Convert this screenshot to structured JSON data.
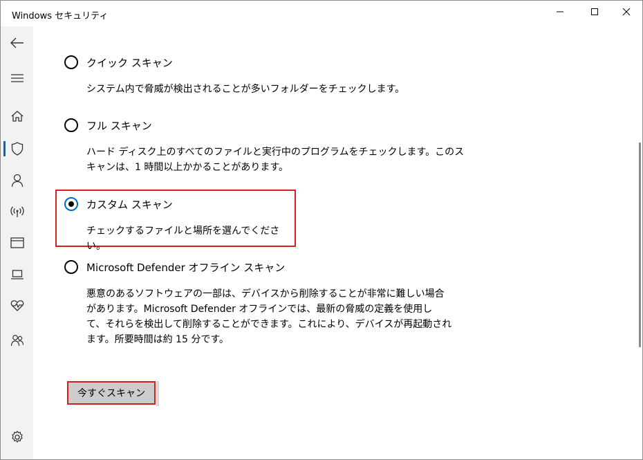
{
  "window": {
    "title": "Windows セキュリティ",
    "controls": [
      "minimize-icon",
      "maximize-icon",
      "close-icon"
    ]
  },
  "sidebar": {
    "items": [
      {
        "icon": "back-arrow-icon"
      },
      {
        "icon": "hamburger-menu-icon"
      },
      {
        "icon": "home-icon"
      },
      {
        "icon": "shield-icon",
        "active": true
      },
      {
        "icon": "person-icon"
      },
      {
        "icon": "network-icon"
      },
      {
        "icon": "app-browser-icon"
      },
      {
        "icon": "laptop-icon"
      },
      {
        "icon": "heart-pulse-icon"
      },
      {
        "icon": "family-icon"
      },
      {
        "icon": "gear-icon"
      }
    ],
    "accent": "#0067c0"
  },
  "scan_options": [
    {
      "label": "クイック スキャン",
      "description": "システム内で脅威が検出されることが多いフォルダーをチェックします。",
      "selected": false
    },
    {
      "label": "フル スキャン",
      "description_lines": [
        "ハード ディスク上のすべてのファイルと実行中のプログラムをチェックします。このス",
        "キャンは、1 時間以上かかることがあります。"
      ],
      "selected": false
    },
    {
      "label": "カスタム スキャン",
      "description": "チェックするファイルと場所を選んでください。",
      "selected": true
    },
    {
      "label": "Microsoft Defender オフライン スキャン",
      "description_lines": [
        "悪意のあるソフトウェアの一部は、デバイスから削除することが非常に難しい場合",
        "があります。Microsoft Defender オフラインでは、最新の脅威の定義を使用し",
        "て、それらを検出して削除することができます。これにより、デバイスが再起動され",
        "ます。所要時間は約 15 分です。"
      ],
      "selected": false
    }
  ],
  "scan_button": {
    "label": "今すぐスキャン"
  },
  "colors": {
    "highlight": "#d0201f",
    "button_bg": "#cccccc",
    "sidebar_bg": "#f2f2f2"
  }
}
